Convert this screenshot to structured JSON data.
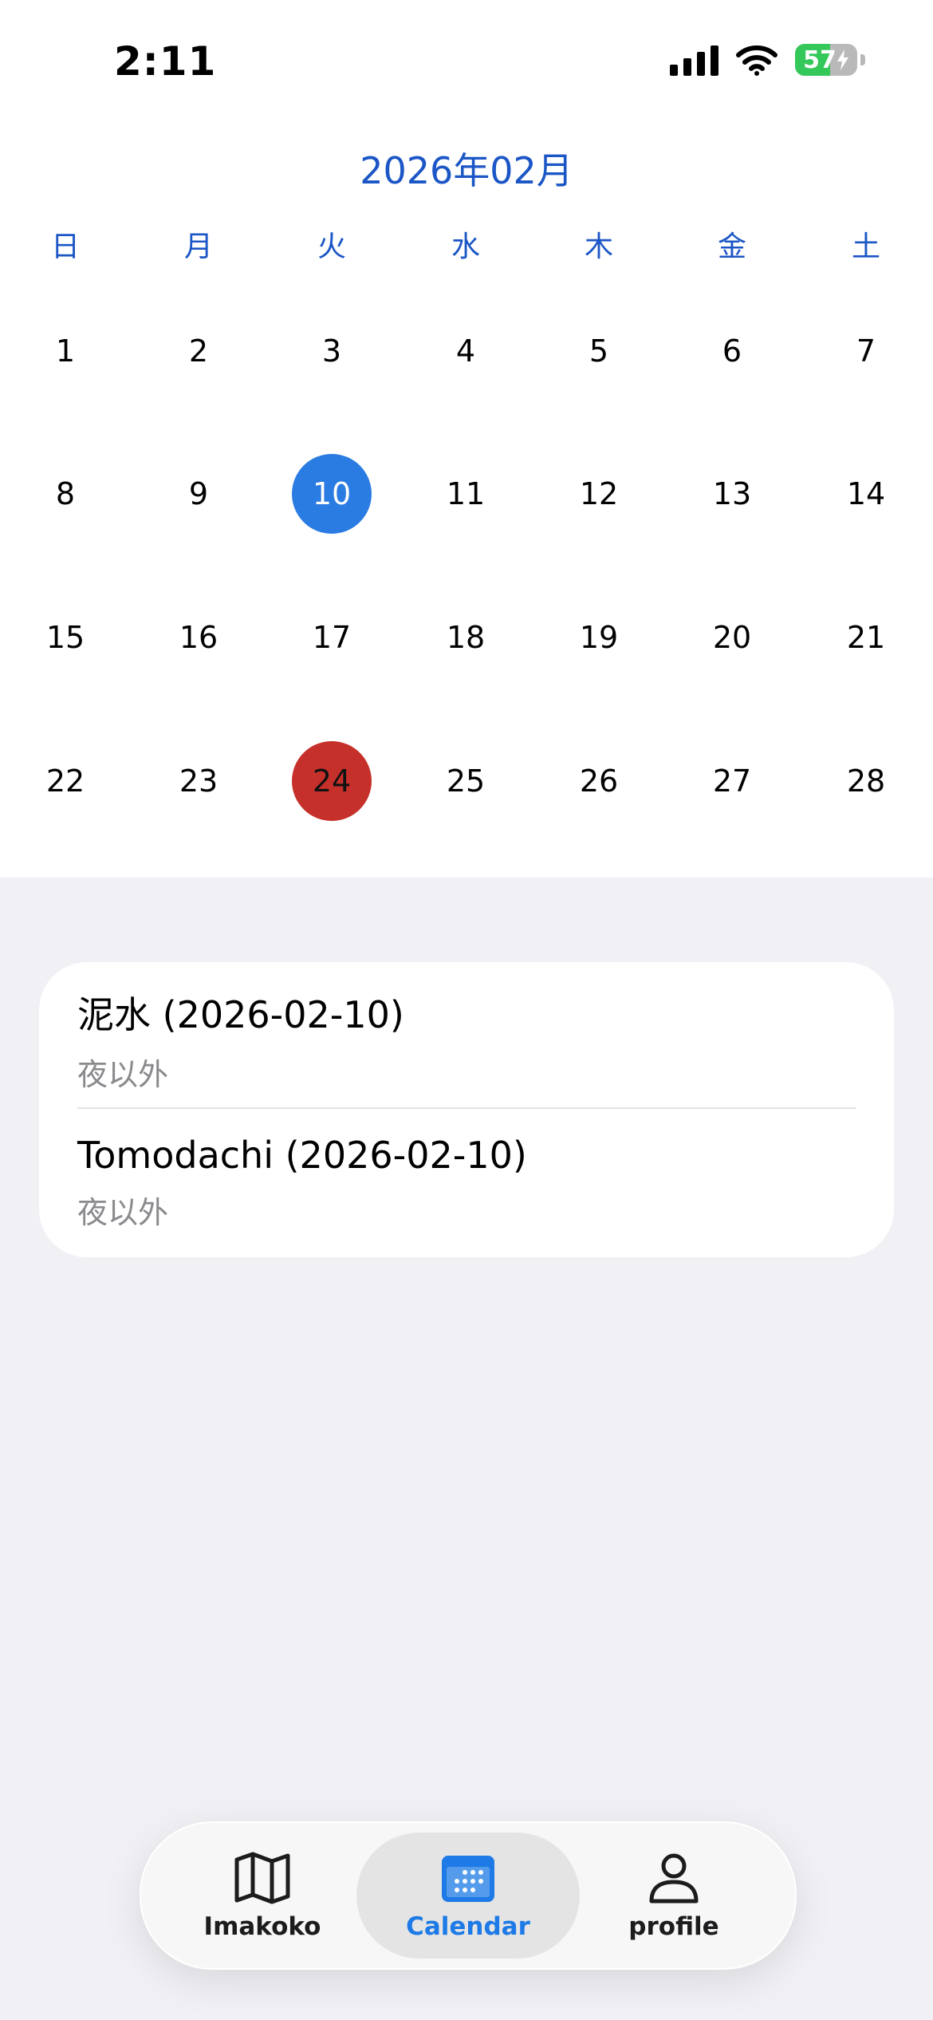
{
  "status_bar": {
    "time": "2:11",
    "battery_level": "57",
    "battery_charging": true
  },
  "calendar": {
    "month_title": "2026年02月",
    "weekdays": [
      "日",
      "月",
      "火",
      "水",
      "木",
      "金",
      "土"
    ],
    "days": [
      [
        "1",
        "2",
        "3",
        "4",
        "5",
        "6",
        "7"
      ],
      [
        "8",
        "9",
        "10",
        "11",
        "12",
        "13",
        "14"
      ],
      [
        "15",
        "16",
        "17",
        "18",
        "19",
        "20",
        "21"
      ],
      [
        "22",
        "23",
        "24",
        "25",
        "26",
        "27",
        "28"
      ]
    ],
    "selected_day": "10",
    "marked_day": "24",
    "colors": {
      "accent": "#1b56c6",
      "selected": "#2a7be2",
      "marked": "#c6302a"
    }
  },
  "events": [
    {
      "title": "泥水 (2026-02-10)",
      "subtitle": "夜以外"
    },
    {
      "title": "Tomodachi (2026-02-10)",
      "subtitle": "夜以外"
    }
  ],
  "tab_bar": {
    "tabs": [
      {
        "label": "Imakoko",
        "icon": "map-icon",
        "active": false
      },
      {
        "label": "Calendar",
        "icon": "calendar-icon",
        "active": true
      },
      {
        "label": "profile",
        "icon": "person-icon",
        "active": false
      }
    ],
    "active_color": "#1d7ae6"
  }
}
